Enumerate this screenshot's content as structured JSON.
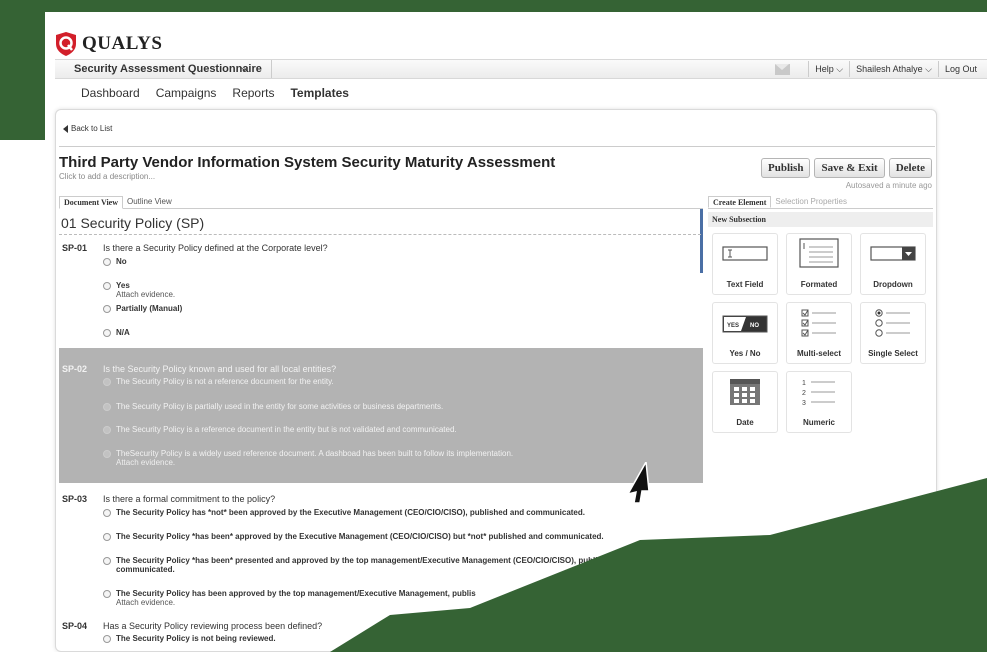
{
  "brand": {
    "name": "QUALYS",
    "shield_color": "#d21f2a",
    "green": "#356334"
  },
  "topbar": {
    "app_name": "Security Assessment Questionnaire",
    "help": "Help",
    "user": "Shailesh Athalye",
    "logout": "Log Out"
  },
  "nav": [
    "Dashboard",
    "Campaigns",
    "Reports",
    "Templates"
  ],
  "page": {
    "back": "Back to List",
    "title": "Third Party Vendor Information System Security Maturity Assessment",
    "subtitle": "Click to add a description...",
    "publish": "Publish",
    "save_exit": "Save & Exit",
    "delete": "Delete",
    "autosave": "Autosaved a minute ago"
  },
  "doc_tabs": [
    "Document View",
    "Outline View"
  ],
  "section_title": "01 Security Policy (SP)",
  "questions": [
    {
      "id": "SP-01",
      "text": "Is there a Security Policy defined at the Corporate level?",
      "options": [
        "No",
        "Yes",
        "Partially (Manual)",
        "N/A"
      ],
      "note": "Attach evidence."
    },
    {
      "id": "SP-02",
      "text": "Is the Security Policy known and used for all local entities?",
      "options": [
        "The Security Policy is not a reference document for the entity.",
        "The Security Policy is partially used in the entity for some activities or business departments.",
        "The Security Policy is a reference document in the entity but is not validated and communicated.",
        "TheSecurity Policy is a widely used reference document. A dashboad has been built to follow its implementation."
      ],
      "note": "Attach evidence."
    },
    {
      "id": "SP-03",
      "text": "Is there a formal commitment to the policy?",
      "options": [
        "The Security Policy has *not* been approved by the Executive Management (CEO/CIO/CISO), published and communicated.",
        "The Security Policy *has been* approved by the Executive Management (CEO/CIO/CISO) but *not* published and communicated.",
        "The Security Policy *has been* presented and approved by the top management/Executive Management (CEO/CIO/CISO), published b",
        "The Security Policy has been approved by the top management/Executive Management, publis"
      ],
      "option3_cont": "communicated.",
      "note": "Attach evidence."
    },
    {
      "id": "SP-04",
      "text": "Has a Security Policy reviewing process been defined?",
      "options": [
        "The Security Policy is not being reviewed."
      ]
    }
  ],
  "right_panel": {
    "tabs": [
      "Create Element",
      "Selection Properties"
    ],
    "header": "New Subsection",
    "elements": [
      "Text Field",
      "Formated",
      "Dropdown",
      "Yes / No",
      "Multi-select",
      "Single Select",
      "Date",
      "Numeric"
    ],
    "yesno_yes": "YES",
    "yesno_no": "NO",
    "numeric_digits": [
      "1",
      "2",
      "3"
    ]
  }
}
